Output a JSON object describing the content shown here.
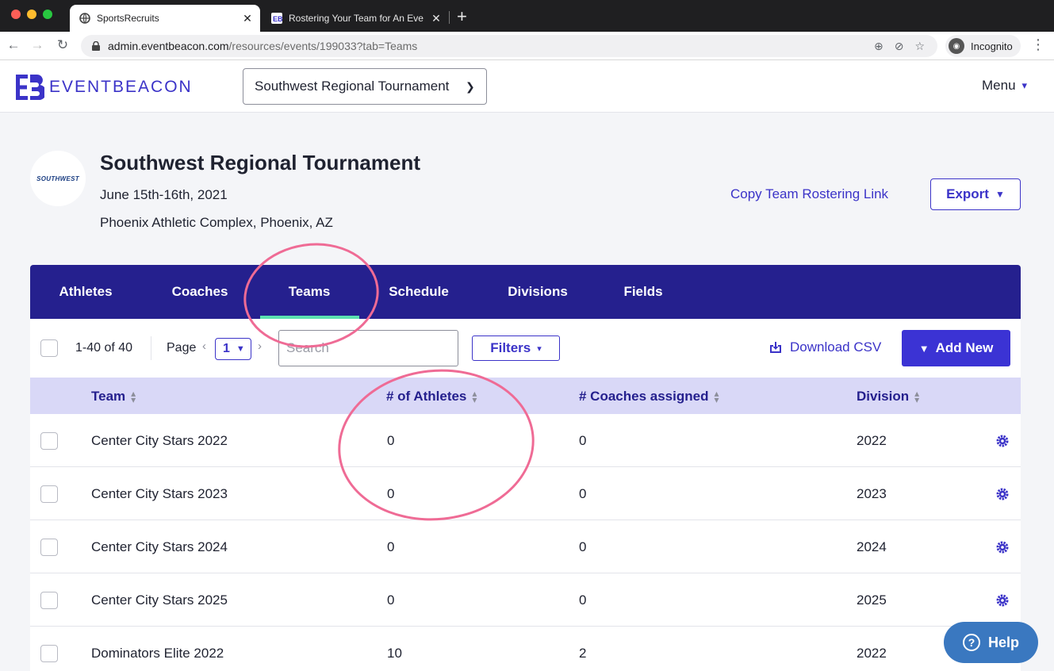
{
  "browser": {
    "tabs": [
      {
        "title": "SportsRecruits",
        "active": true
      },
      {
        "title": "Rostering Your Team for An Eve",
        "active": false
      }
    ],
    "url_domain": "admin.eventbeacon.com",
    "url_path": "/resources/events/199033?tab=Teams",
    "incognito_label": "Incognito"
  },
  "header": {
    "brand": "EVENTBEACON",
    "event_selector": "Southwest Regional Tournament",
    "menu_label": "Menu"
  },
  "event": {
    "logo_text": "SOUTHWEST",
    "title": "Southwest Regional Tournament",
    "date": "June 15th-16th, 2021",
    "location": "Phoenix Athletic Complex, Phoenix, AZ",
    "copy_link_label": "Copy Team Rostering Link",
    "export_label": "Export"
  },
  "tabs": [
    {
      "label": "Athletes",
      "active": false
    },
    {
      "label": "Coaches",
      "active": false
    },
    {
      "label": "Teams",
      "active": true
    },
    {
      "label": "Schedule",
      "active": false
    },
    {
      "label": "Divisions",
      "active": false
    },
    {
      "label": "Fields",
      "active": false
    }
  ],
  "controls": {
    "count": "1-40 of 40",
    "page_label": "Page",
    "page_value": "1",
    "search_placeholder": "Search",
    "filters_label": "Filters",
    "download_label": "Download CSV",
    "add_new_label": "Add New"
  },
  "table": {
    "columns": [
      "Team",
      "# of Athletes",
      "# Coaches assigned",
      "Division"
    ],
    "rows": [
      {
        "team": "Center City Stars 2022",
        "athletes": "0",
        "coaches": "0",
        "division": "2022"
      },
      {
        "team": "Center City Stars 2023",
        "athletes": "0",
        "coaches": "0",
        "division": "2023"
      },
      {
        "team": "Center City Stars 2024",
        "athletes": "0",
        "coaches": "0",
        "division": "2024"
      },
      {
        "team": "Center City Stars 2025",
        "athletes": "0",
        "coaches": "0",
        "division": "2025"
      },
      {
        "team": "Dominators Elite 2022",
        "athletes": "10",
        "coaches": "2",
        "division": "2022"
      }
    ]
  },
  "help_label": "Help",
  "colors": {
    "brand": "#3b33c8",
    "tab_bar": "#25208e",
    "tab_active_underline": "#5ce1b0",
    "table_header": "#d9d8f7",
    "annotation": "#ef6b95",
    "help_button": "#3a78c0"
  }
}
